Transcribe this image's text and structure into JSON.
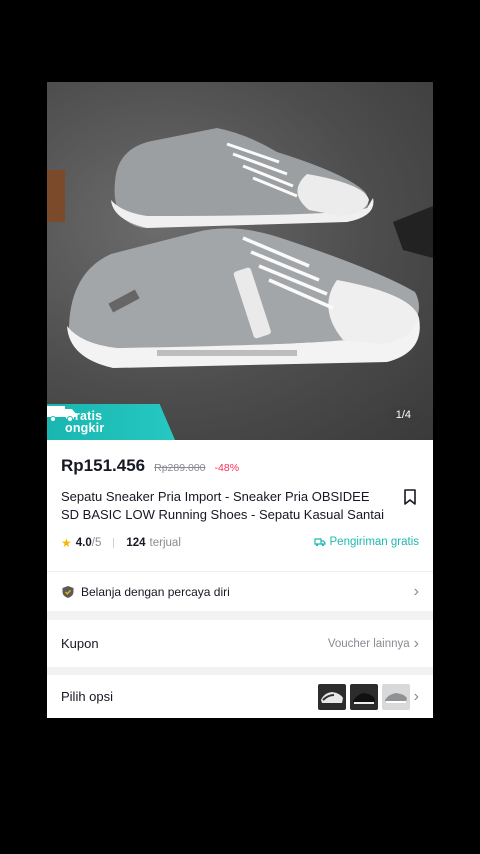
{
  "product_image": {
    "badge": {
      "line1": "Gratis",
      "line2": "ongkir"
    },
    "counter": "1/4"
  },
  "info": {
    "price": "Rp151.456",
    "original_price": "Rp289.000",
    "discount": "-48%",
    "title": "Sepatu Sneaker Pria Import - Sneaker Pria OBSIDEE SD BASIC LOW Running Shoes - Sepatu Kasual Santai",
    "rating": "4.0",
    "rating_max": "/5",
    "sold_count": "124",
    "sold_label": "terjual",
    "shipping": "Pengiriman gratis"
  },
  "trust_row": {
    "label": "Belanja dengan percaya diri"
  },
  "coupon_row": {
    "label": "Kupon",
    "action": "Voucher lainnya"
  },
  "options_row": {
    "label": "Pilih opsi"
  },
  "colors": {
    "teal": "#20b8b0",
    "discount_red": "#fe2c55",
    "star": "#f5b800"
  }
}
